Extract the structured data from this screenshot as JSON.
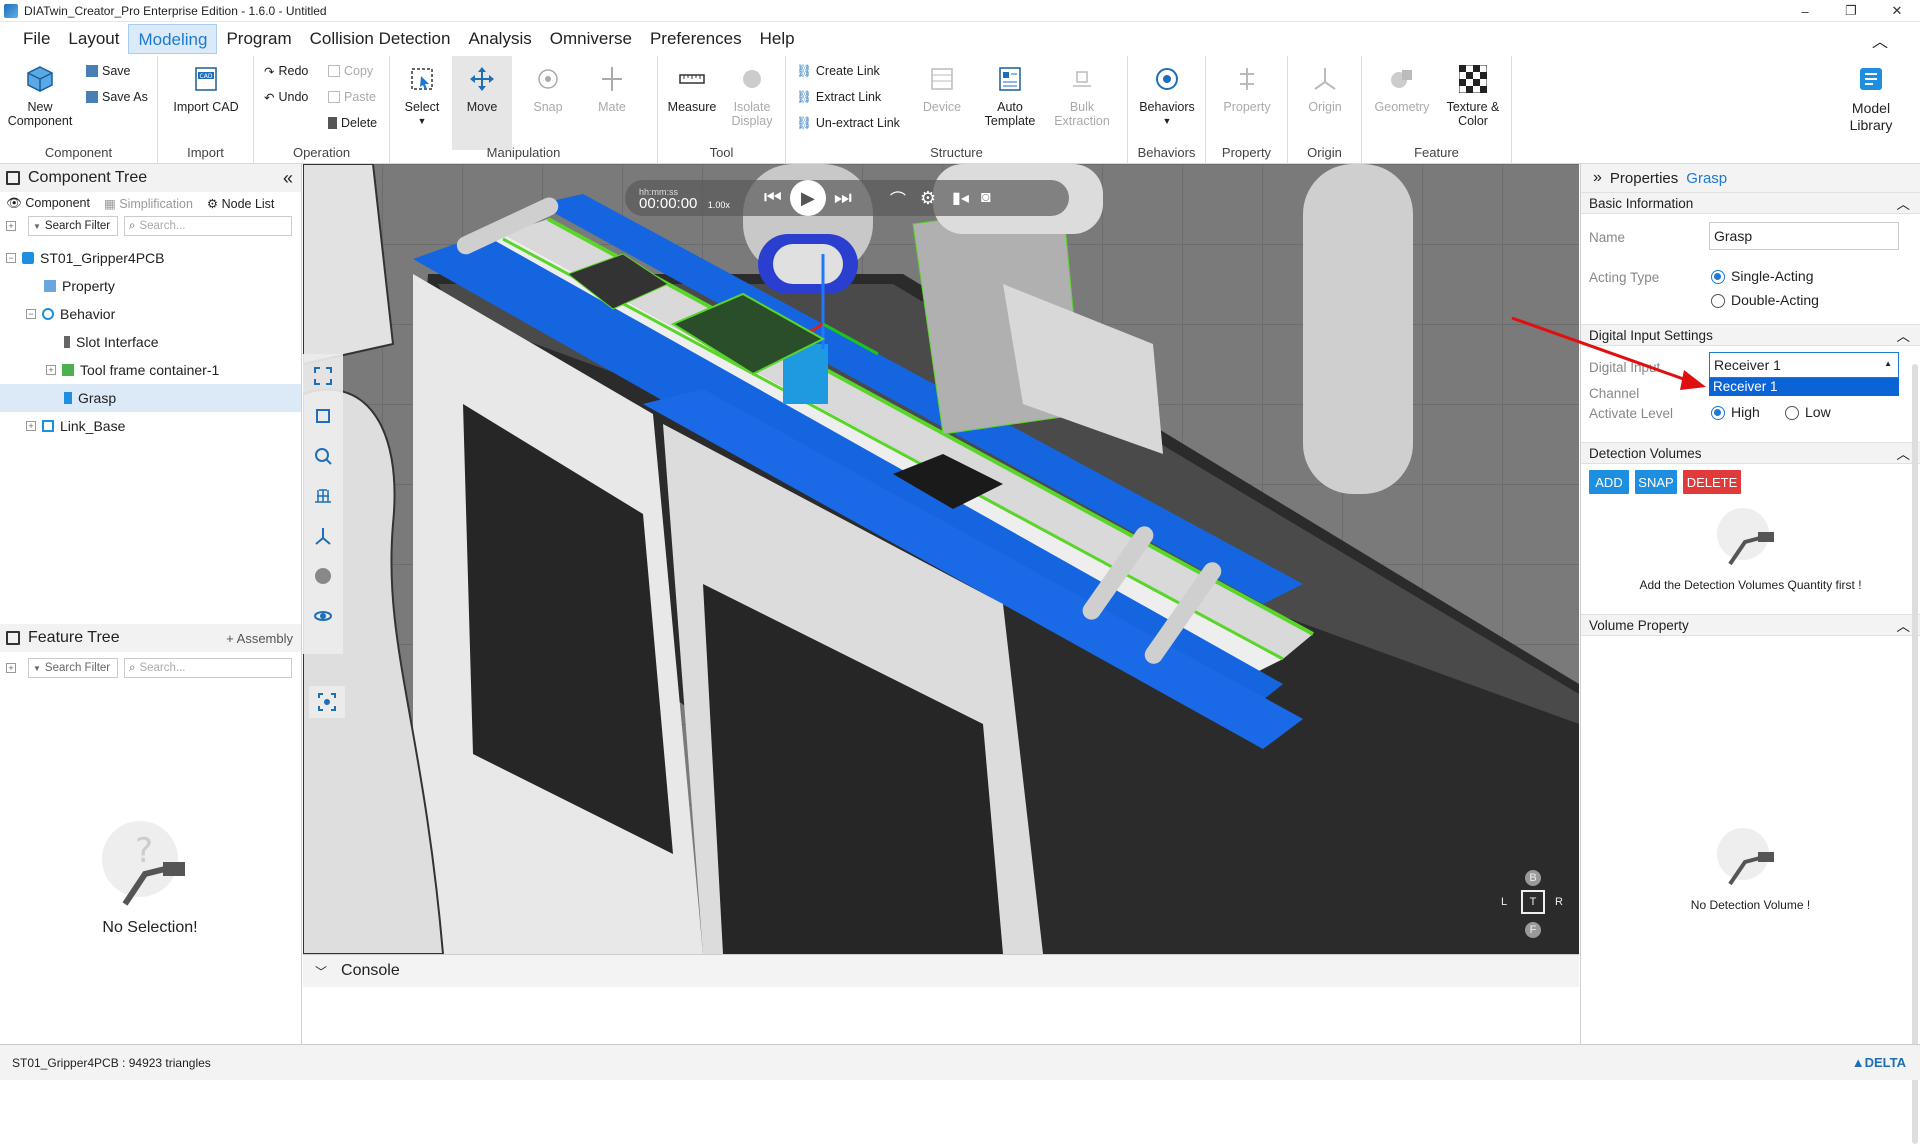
{
  "window": {
    "title": "DIATwin_Creator_Pro Enterprise Edition - 1.6.0 - Untitled",
    "controls": [
      "–",
      "❐",
      "✕"
    ]
  },
  "menu": {
    "items": [
      "File",
      "Layout",
      "Modeling",
      "Program",
      "Collision Detection",
      "Analysis",
      "Omniverse",
      "Preferences",
      "Help"
    ],
    "active": "Modeling"
  },
  "ribbon": {
    "component": {
      "label": "Component",
      "new_component": "New Component",
      "save": "Save",
      "save_as": "Save As"
    },
    "import": {
      "label": "Import",
      "import_cad": "Import CAD"
    },
    "operation": {
      "label": "Operation",
      "redo": "Redo",
      "undo": "Undo",
      "copy": "Copy",
      "paste": "Paste",
      "delete": "Delete"
    },
    "manipulation": {
      "label": "Manipulation",
      "select": "Select",
      "move": "Move",
      "snap": "Snap",
      "mate": "Mate"
    },
    "tool": {
      "label": "Tool",
      "measure": "Measure",
      "isolate_display": "Isolate Display"
    },
    "structure": {
      "label": "Structure",
      "create_link": "Create Link",
      "extract_link": "Extract Link",
      "unextract_link": "Un-extract Link",
      "device": "Device",
      "auto_template": "Auto Template",
      "bulk_extraction": "Bulk Extraction"
    },
    "behaviors": {
      "label": "Behaviors",
      "behaviors": "Behaviors"
    },
    "property": {
      "label": "Property",
      "property": "Property"
    },
    "origin": {
      "label": "Origin",
      "origin": "Origin"
    },
    "feature": {
      "label": "Feature",
      "geometry": "Geometry",
      "texture_color": "Texture & Color"
    },
    "model_library": "Model Library"
  },
  "component_tree": {
    "title": "Component Tree",
    "tabs": [
      "Component",
      "Simplification",
      "Node List"
    ],
    "filter_label": "Search Filter",
    "search_placeholder": "Search...",
    "nodes": [
      {
        "label": "ST01_Gripper4PCB",
        "level": 0,
        "toggle": "⊟"
      },
      {
        "label": "Property",
        "level": 1,
        "toggle": ""
      },
      {
        "label": "Behavior",
        "level": 1,
        "toggle": "⊟"
      },
      {
        "label": "Slot Interface",
        "level": 2,
        "toggle": ""
      },
      {
        "label": "Tool frame container-1",
        "level": 2,
        "toggle": "⊞"
      },
      {
        "label": "Grasp",
        "level": 2,
        "toggle": "",
        "selected": true
      },
      {
        "label": "Link_Base",
        "level": 1,
        "toggle": "⊞"
      }
    ]
  },
  "feature_tree": {
    "title": "Feature Tree",
    "assembly_label": "+ Assembly",
    "filter_label": "Search Filter",
    "search_placeholder": "Search...",
    "empty_text": "No Selection!"
  },
  "playback": {
    "format_label": "hh:mm:ss",
    "time": "00:00:00",
    "speed": "1.00x"
  },
  "viewcube": {
    "labels": [
      "B",
      "L",
      "T",
      "R",
      "F"
    ]
  },
  "console": {
    "title": "Console"
  },
  "properties": {
    "title": "Properties",
    "object": "Grasp",
    "basic_info": {
      "section": "Basic Information",
      "name_label": "Name",
      "name_value": "Grasp",
      "acting_type_label": "Acting Type",
      "options": [
        "Single-Acting",
        "Double-Acting"
      ],
      "selected": "Single-Acting"
    },
    "digital_input": {
      "section": "Digital Input Settings",
      "input_label": "Digital Input",
      "input_value": "Receiver 1",
      "dropdown_options": [
        "Receiver 1"
      ],
      "channel_label": "Channel",
      "level_label": "Activate Level",
      "levels": [
        "High",
        "Low"
      ],
      "selected_level": "High"
    },
    "detection": {
      "section": "Detection Volumes",
      "add": "ADD",
      "snap": "SNAP",
      "delete": "DELETE",
      "empty_text": "Add the Detection Volumes Quantity first !"
    },
    "volume_property": {
      "section": "Volume Property",
      "empty_text": "No Detection Volume !"
    }
  },
  "status": {
    "text": "ST01_Gripper4PCB : 94923 triangles",
    "brand": "DELTA"
  },
  "colors": {
    "accent": "#1e7ad1",
    "add": "#1e8fe0",
    "snap": "#1e8fe0",
    "delete": "#e03a3a",
    "conveyor_blue": "#1565e0",
    "highlight_green": "#5ad62a"
  }
}
